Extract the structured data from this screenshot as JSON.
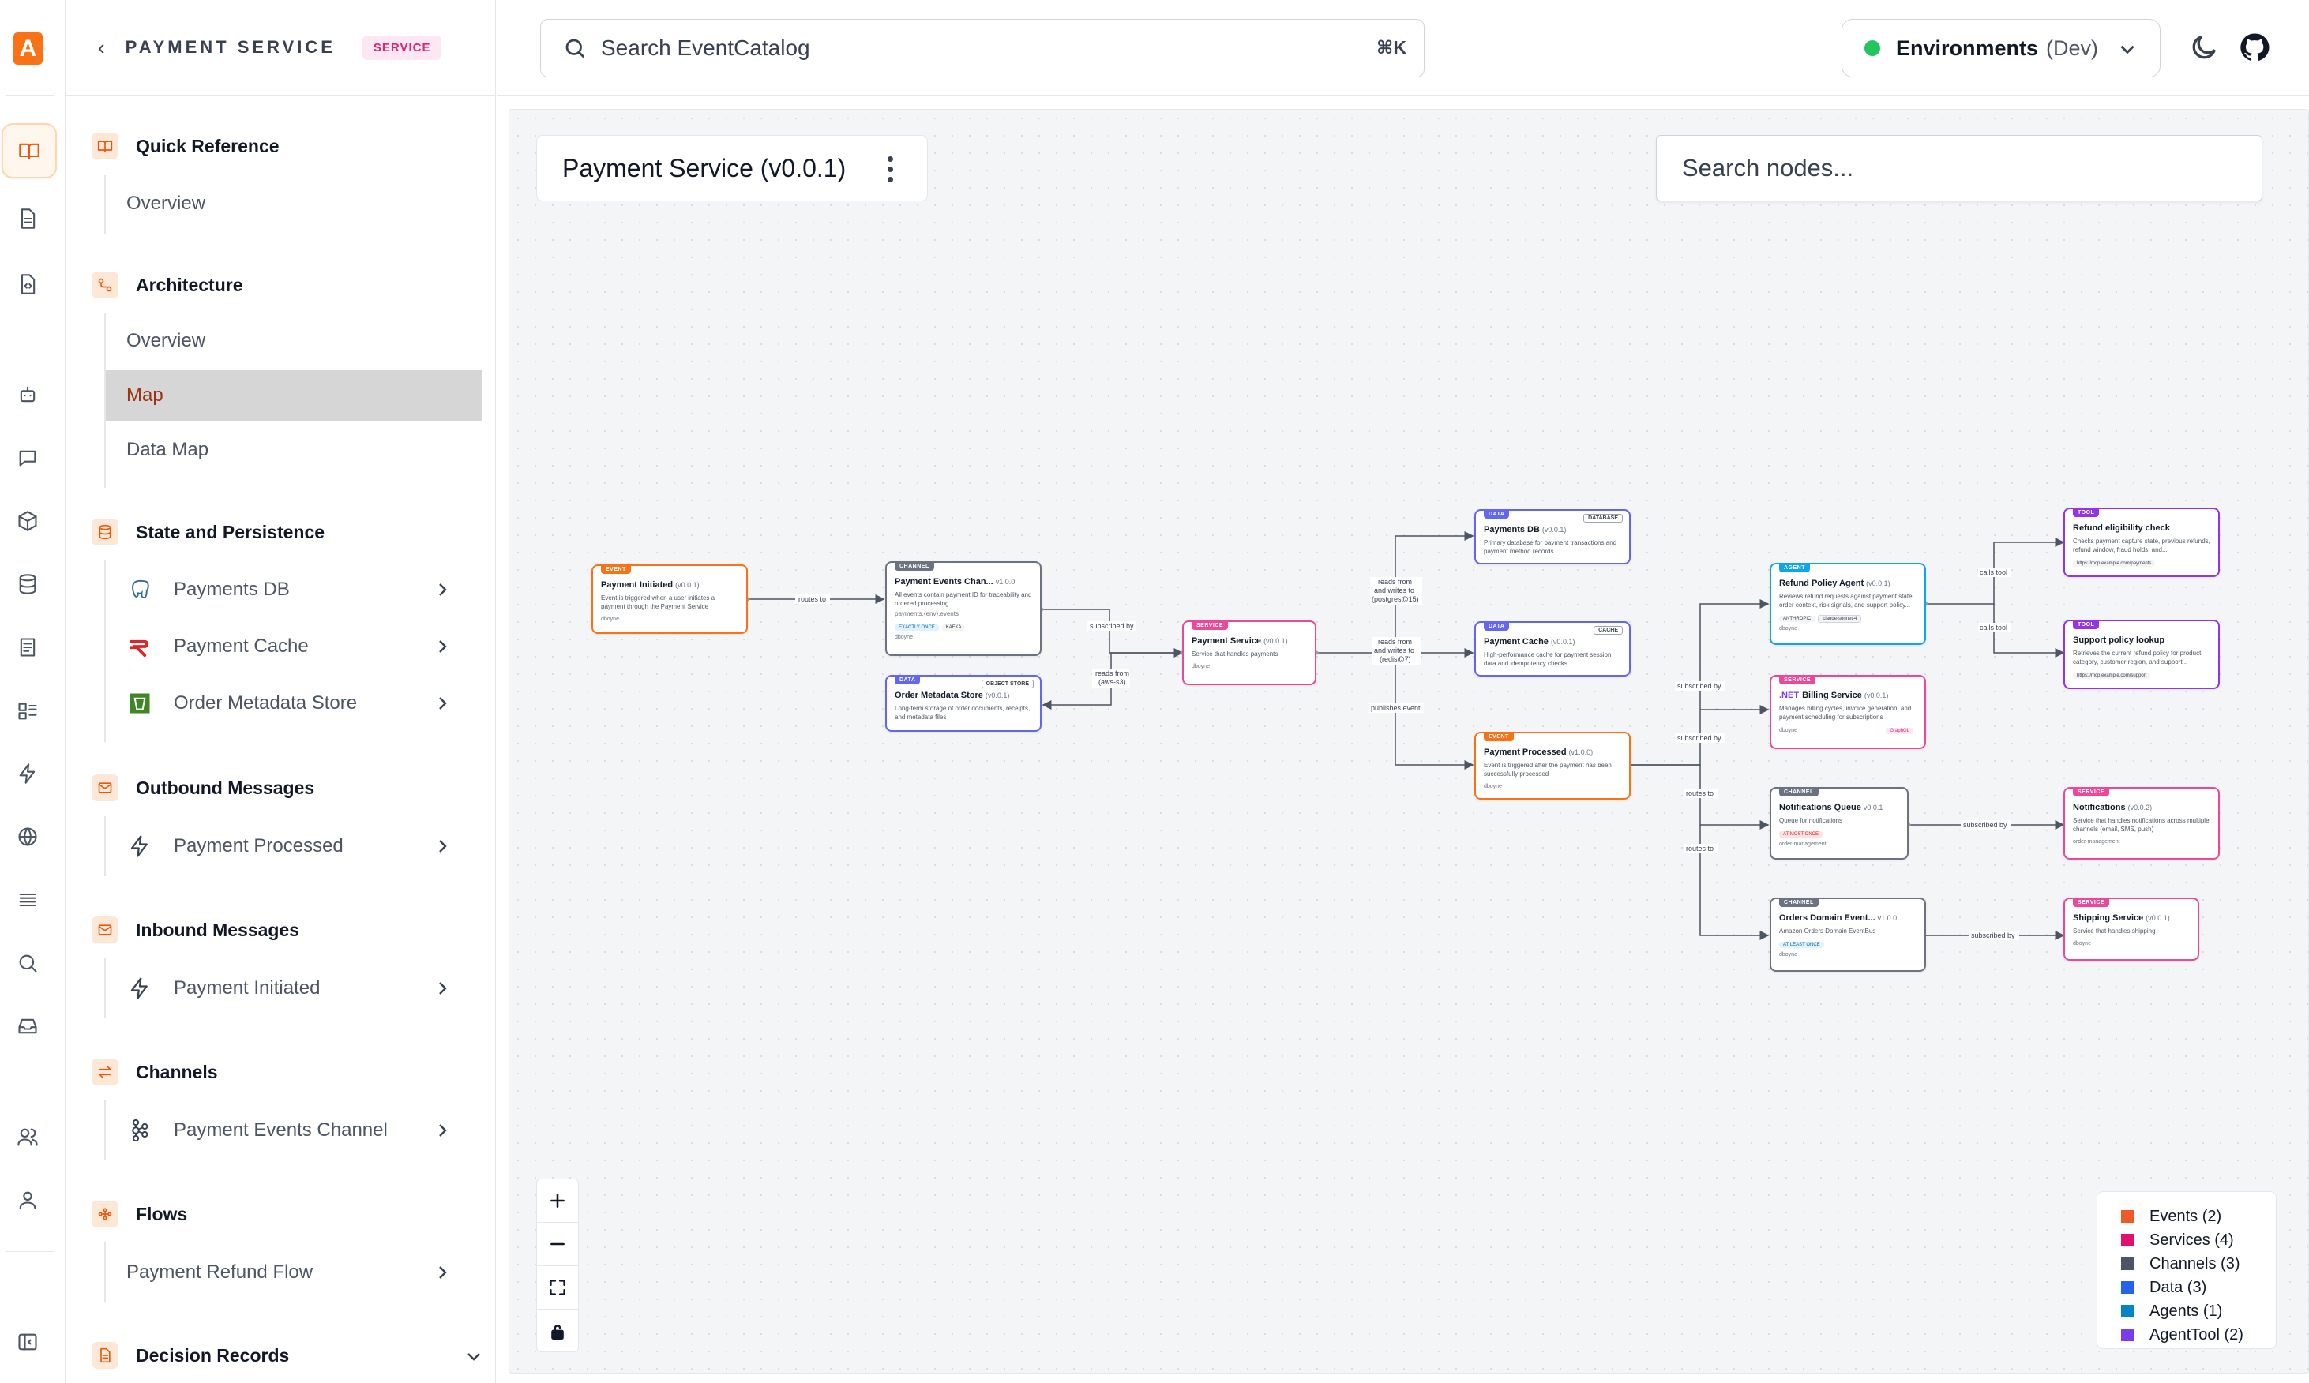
{
  "rail": {
    "logo": "A",
    "icons": [
      "docs-icon",
      "file-icon",
      "code-file-icon",
      "bot-icon",
      "chat-icon",
      "cube-icon",
      "database-icon",
      "list-icon",
      "layout-icon",
      "bolt-icon",
      "globe-icon",
      "stack-icon",
      "search-icon",
      "inbox-icon",
      "users-icon",
      "user-icon",
      "panel-collapse-icon"
    ]
  },
  "sidebar": {
    "back_label": "PAYMENT SERVICE",
    "badge": "SERVICE",
    "sections": {
      "quick_reference": {
        "label": "Quick Reference",
        "items": [
          "Overview"
        ]
      },
      "architecture": {
        "label": "Architecture",
        "items": [
          "Overview",
          "Map",
          "Data Map"
        ]
      },
      "state": {
        "label": "State and Persistence",
        "items": [
          "Payments DB",
          "Payment Cache",
          "Order Metadata Store"
        ]
      },
      "outbound": {
        "label": "Outbound Messages",
        "items": [
          "Payment Processed"
        ]
      },
      "inbound": {
        "label": "Inbound Messages",
        "items": [
          "Payment Initiated"
        ]
      },
      "channels": {
        "label": "Channels",
        "items": [
          "Payment Events Channel"
        ]
      },
      "flows": {
        "label": "Flows",
        "items": [
          "Payment Refund Flow"
        ]
      },
      "decision_records": {
        "label": "Decision Records"
      }
    }
  },
  "topbar": {
    "search_placeholder": "Search EventCatalog",
    "search_shortcut": "⌘K",
    "env_label": "Environments",
    "env_value": "(Dev)"
  },
  "canvas": {
    "title": "Payment Service (v0.0.1)",
    "node_search_placeholder": "Search nodes...",
    "nodes": {
      "payment_initiated": {
        "tag": "EVENT",
        "name": "Payment Initiated",
        "version": "(v0.0.1)",
        "desc": "Event is triggered when a user initiates a payment through the Payment Service",
        "owner": "dboyne"
      },
      "payment_events_channel": {
        "tag": "CHANNEL",
        "name": "Payment Events Chan...",
        "version": "v1.0.0",
        "desc": "All events contain payment ID for traceability and ordered processing",
        "address": "payments.{env}.events",
        "pill1": "EXACTLY ONCE",
        "pill2": "KAFKA",
        "owner": "dboyne"
      },
      "order_metadata_store": {
        "tag": "DATA",
        "tag_right": "OBJECT STORE",
        "name": "Order Metadata Store",
        "version": "(v0.0.1)",
        "desc": "Long-term storage of order documents, receipts, and metadata files"
      },
      "payment_service": {
        "tag": "SERVICE",
        "name": "Payment Service",
        "version": "(v0.0.1)",
        "desc": "Service that handles payments",
        "owner": "dboyne"
      },
      "payments_db": {
        "tag": "DATA",
        "tag_right": "DATABASE",
        "name": "Payments DB",
        "version": "(v0.0.1)",
        "desc": "Primary database for payment transactions and payment method records"
      },
      "payment_cache": {
        "tag": "DATA",
        "tag_right": "CACHE",
        "name": "Payment Cache",
        "version": "(v0.0.1)",
        "desc": "High-performance cache for payment session data and idempotency checks"
      },
      "payment_processed": {
        "tag": "EVENT",
        "name": "Payment Processed",
        "version": "(v1.0.0)",
        "desc": "Event is triggered after the payment has been successfully processed",
        "owner": "dboyne"
      },
      "refund_policy_agent": {
        "tag": "AGENT",
        "name": "Refund Policy Agent",
        "version": "(v0.0.1)",
        "desc": "Reviews refund requests against payment state, order context, risk signals, and support policy...",
        "pill1": "ANTHROPIC",
        "pill2": "claude-sonnet-4",
        "owner": "dboyne"
      },
      "billing_service": {
        "tag": "SERVICE",
        "prefix": ".NET",
        "name": "Billing Service",
        "version": "(v0.0.1)",
        "desc": "Manages billing cycles, invoice generation, and payment scheduling for subscriptions",
        "pill1": "GraphQL",
        "owner": "dboyne"
      },
      "notifications_queue": {
        "tag": "CHANNEL",
        "name": "Notifications Queue",
        "version": "v0.0.1",
        "desc": "Queue for notifications",
        "pill1": "AT MOST ONCE",
        "owner": "order-management"
      },
      "orders_domain_eventbus": {
        "tag": "CHANNEL",
        "name": "Orders Domain Event...",
        "version": "v1.0.0",
        "desc": "Amazon Orders Domain EventBus",
        "pill1": "AT LEAST ONCE",
        "owner": "dboyne"
      },
      "refund_eligibility_check": {
        "tag": "TOOL",
        "name": "Refund eligibility check",
        "desc": "Checks payment capture state, previous refunds, refund window, fraud holds, and...",
        "url": "https://mcp.example.com/payments"
      },
      "support_policy_lookup": {
        "tag": "TOOL",
        "name": "Support policy lookup",
        "desc": "Retrieves the current refund policy for product category, customer region, and support...",
        "url": "https://mcp.example.com/support"
      },
      "notifications": {
        "tag": "SERVICE",
        "name": "Notifications",
        "version": "(v0.0.2)",
        "desc": "Service that handles notifications across multiple channels (email, SMS, push)",
        "owner": "order-management"
      },
      "shipping_service": {
        "tag": "SERVICE",
        "name": "Shipping Service",
        "version": "(v0.0.1)",
        "desc": "Service that handles shipping",
        "owner": "dboyne"
      }
    },
    "edge_labels": {
      "routes_to": "routes to",
      "subscribed_by": "subscribed by",
      "reads_from": "reads from",
      "reads_from_s3": "(aws-s3)",
      "reads_writes": "reads from",
      "and_writes_to": "and writes to",
      "postgres": "(postgres@15)",
      "redis": "(redis@7)",
      "publishes_event": "publishes event",
      "calls_tool": "calls tool"
    },
    "legend": [
      {
        "label": "Events (2)",
        "color": "#f05a28"
      },
      {
        "label": "Services (4)",
        "color": "#e0106e"
      },
      {
        "label": "Channels (3)",
        "color": "#4b5563"
      },
      {
        "label": "Data (3)",
        "color": "#2563eb"
      },
      {
        "label": "Agents (1)",
        "color": "#0284c7"
      },
      {
        "label": "AgentTool (2)",
        "color": "#7c3aed"
      }
    ]
  }
}
